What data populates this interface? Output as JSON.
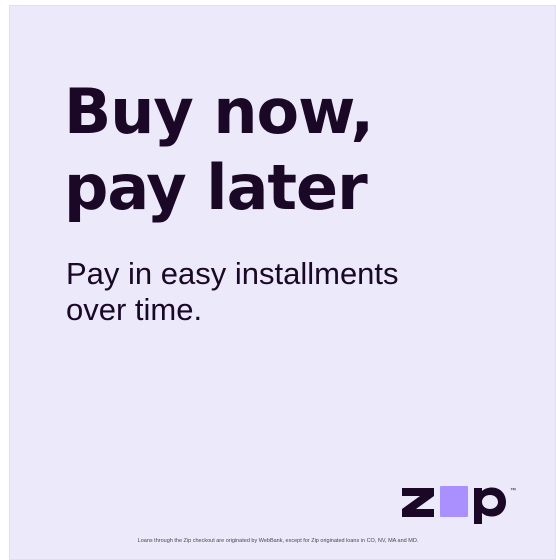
{
  "ad": {
    "headline_line1": "Buy now,",
    "headline_line2": "pay later",
    "subhead_line1": "Pay in easy installments",
    "subhead_line2": "over time.",
    "disclaimer": "Loans through the Zip checkout are originated by WebBank, except for Zip originated loans in CO, NV, MA and MD.",
    "logo_text": "zip",
    "logo_trademark": "™"
  },
  "colors": {
    "background": "#ece9fb",
    "text": "#1a0826",
    "logo_accent": "#aa8fff"
  }
}
